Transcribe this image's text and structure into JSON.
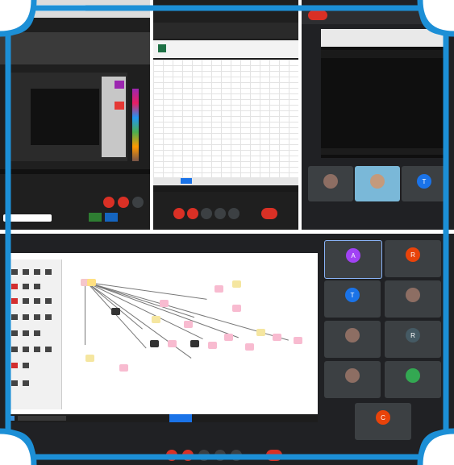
{
  "panels": {
    "top_left": {
      "window_title": "",
      "notice": "",
      "caption": "",
      "search_placeholder": ""
    },
    "top_mid": {
      "sheet_tab": ""
    },
    "top_right": {
      "header_chip": "",
      "title": "",
      "time": "",
      "caption": ""
    }
  },
  "tiles_top_right": [
    {
      "initial": "",
      "name": "",
      "color": "#5f6368"
    },
    {
      "initial": "",
      "name": "",
      "color": "#5f6368"
    },
    {
      "initial": "T",
      "name": "",
      "color": "#1a73e8"
    }
  ],
  "tiles_bottom": [
    {
      "initial": "A",
      "name": "",
      "color": "#a142f4"
    },
    {
      "initial": "R",
      "name": "",
      "color": "#e8430a"
    },
    {
      "initial": "T",
      "name": "",
      "color": "#1a73e8"
    },
    {
      "initial": "",
      "name": "",
      "color": "#8d6e63"
    },
    {
      "initial": "",
      "name": "",
      "color": "#8d6e63"
    },
    {
      "initial": "R",
      "name": "",
      "color": "#455a64"
    },
    {
      "initial": "",
      "name": "",
      "color": "#8d6e63"
    },
    {
      "initial": "",
      "name": "",
      "color": "#33a852"
    },
    {
      "initial": "C",
      "name": "",
      "color": "#e8430a"
    }
  ],
  "colors": {
    "frame_blue": "#1c8fd6",
    "meet_bg": "#202124",
    "tile": "#3c4043",
    "end_call_red": "#d93025"
  }
}
